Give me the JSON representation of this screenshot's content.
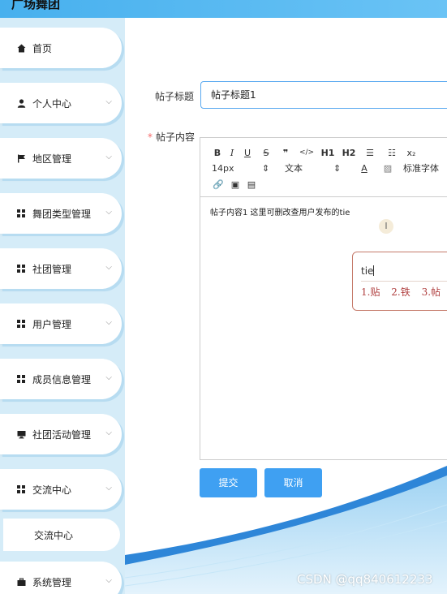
{
  "app": {
    "title": "广场舞团"
  },
  "sidebar": {
    "items": [
      {
        "label": "首页",
        "icon": "home-icon"
      },
      {
        "label": "个人中心",
        "icon": "user-icon"
      },
      {
        "label": "地区管理",
        "icon": "flag-icon"
      },
      {
        "label": "舞团类型管理",
        "icon": "grid-icon"
      },
      {
        "label": "社团管理",
        "icon": "grid-icon"
      },
      {
        "label": "用户管理",
        "icon": "grid-icon"
      },
      {
        "label": "成员信息管理",
        "icon": "grid-icon"
      },
      {
        "label": "社团活动管理",
        "icon": "monitor-icon"
      },
      {
        "label": "交流中心",
        "icon": "grid-icon"
      },
      {
        "label": "系统管理",
        "icon": "briefcase-icon"
      }
    ],
    "sub_item": "交流中心"
  },
  "form": {
    "title_label": "帖子标题",
    "title_value": "帖子标题1",
    "content_label": "帖子内容",
    "content_text": "帖子内容1  这里可删改查用户发布的tie"
  },
  "editor": {
    "font_size": "14px",
    "text_type": "文本",
    "font_family": "标准字体",
    "h1": "H1",
    "h2": "H2"
  },
  "ime": {
    "typed": "tie",
    "candidates": [
      "1.贴",
      "2.铁",
      "3.帖"
    ]
  },
  "buttons": {
    "submit": "提交",
    "cancel": "取消"
  },
  "watermark": "CSDN @qq840612233",
  "colors": {
    "primary": "#3fa0f2",
    "sidebar_bg": "#d5ecf8",
    "topbar": "#47b0ee"
  }
}
